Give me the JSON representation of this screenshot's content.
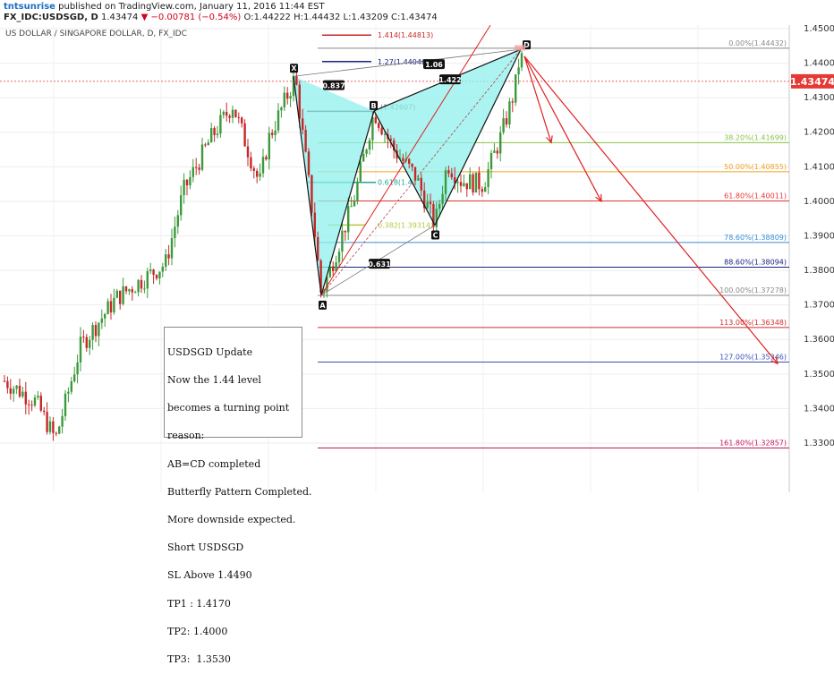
{
  "header": {
    "author": "tntsunrise",
    "published": "published on TradingView.com, January 11, 2016 11:44 EST",
    "symbol": "FX_IDC:USDSGD, D",
    "last": "1.43474",
    "change": "−0.00781 (−0.54%)",
    "ohlc": "O:1.44222 H:1.44432 L:1.43209 C:1.43474"
  },
  "chart_title": "US DOLLAR / SINGAPORE DOLLAR, D, FX_IDC",
  "price_tag": "1.43474",
  "note_lines": [
    "USDSGD Update",
    "Now the 1.44 level",
    "becomes a turning point",
    "reason:",
    "AB=CD completed",
    "Butterfly Pattern Completed.",
    "More downside expected.",
    "Short USDSGD",
    "SL Above 1.4490",
    "TP1 : 1.4170",
    "TP2: 1.4000",
    "TP3:  1.3530"
  ],
  "colors": {
    "up": "#3c9a3c",
    "down": "#c62828",
    "pattern_fill": "#8ff0ee",
    "arrow": "#e02020",
    "price_line": "#e03030"
  },
  "chart_data": {
    "type": "candlestick",
    "ylim": [
      1.32,
      1.45
    ],
    "y_ticks": [
      "1.45000",
      "1.44000",
      "1.43000",
      "1.42000",
      "1.41000",
      "1.40000",
      "1.39000",
      "1.38000",
      "1.37000",
      "1.36000",
      "1.35000",
      "1.34000",
      "1.33000"
    ],
    "last_price": 1.43474,
    "fib_levels": [
      {
        "label": "0.00%(1.44432)",
        "price": 1.44432,
        "color": "#888888"
      },
      {
        "label": "38.20%(1.41699)",
        "price": 1.41699,
        "color": "#8bc34a"
      },
      {
        "label": "50.00%(1.40855)",
        "price": 1.40855,
        "color": "#f2a020"
      },
      {
        "label": "61.80%(1.40011)",
        "price": 1.40011,
        "color": "#e53935"
      },
      {
        "label": "78.60%(1.38809)",
        "price": 1.38809,
        "color": "#3b8ed8"
      },
      {
        "label": "88.60%(1.38094)",
        "price": 1.38094,
        "color": "#1a237e"
      },
      {
        "label": "100.00%(1.37278)",
        "price": 1.37278,
        "color": "#888888"
      },
      {
        "label": "113.00%(1.36348)",
        "price": 1.36348,
        "color": "#d32f2f"
      },
      {
        "label": "127.00%(1.35346)",
        "price": 1.35346,
        "color": "#3f51b5"
      },
      {
        "label": "161.80%(1.32857)",
        "price": 1.32857,
        "color": "#c2185b"
      }
    ],
    "xa_levels": [
      {
        "label": "1.414(1.44813)",
        "price": 1.44813,
        "color": "#c62828"
      },
      {
        "label": "1.27(1.44046)",
        "price": 1.44046,
        "color": "#1a237e"
      },
      {
        "label": "",
        "price": 1.42607,
        "color": "#444444"
      },
      {
        "label": "0.618(1.4",
        "price": 1.4055,
        "color": "#26a69a"
      },
      {
        "label": "0.382(1.39314)",
        "price": 1.39314,
        "color": "#b5c742"
      }
    ],
    "ab_label": "(1.42607)",
    "pattern_points": [
      {
        "name": "X",
        "price": 1.4362
      },
      {
        "name": "A",
        "price": 1.3728
      },
      {
        "name": "B",
        "price": 1.4262
      },
      {
        "name": "C",
        "price": 1.3931
      },
      {
        "name": "D",
        "price": 1.444
      }
    ],
    "ratios": [
      "0.837",
      "1.06",
      "1.422",
      "0.631"
    ],
    "targets": [
      1.417,
      1.4,
      1.353
    ]
  }
}
